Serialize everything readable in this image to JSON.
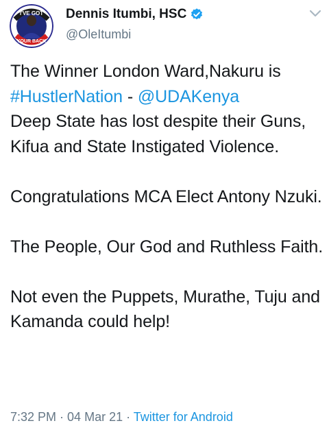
{
  "author": {
    "display_name": "Dennis Itumbi, HSC",
    "handle": "@OleItumbi",
    "avatar_text_top": "I'VE GOT",
    "avatar_text_bottom": "YOUR BACK",
    "verified_icon": "verified-badge-icon"
  },
  "menu_icon": "chevron-down-icon",
  "tweet": {
    "line1": "The Winner London Ward,Nakuru is",
    "hashtag": "#HustlerNation",
    "separator": " - ",
    "mention": "@UDAKenya",
    "para1_rest": "Deep State has lost despite their Guns, Kifua and State Instigated Violence.",
    "para2": "Congratulations MCA Elect Antony Nzuki.",
    "para3": "The People, Our God and Ruthless Faith.",
    "para4": "Not even the Puppets, Murathe, Tuju and Kamanda could help!"
  },
  "meta": {
    "time": "7:32 PM",
    "dot1": " · ",
    "date": "04 Mar 21",
    "dot2": " · ",
    "source": "Twitter for Android"
  },
  "colors": {
    "link": "#1b95e0",
    "secondary_text": "#657786",
    "primary_text": "#14171a",
    "verified": "#1da1f2"
  }
}
